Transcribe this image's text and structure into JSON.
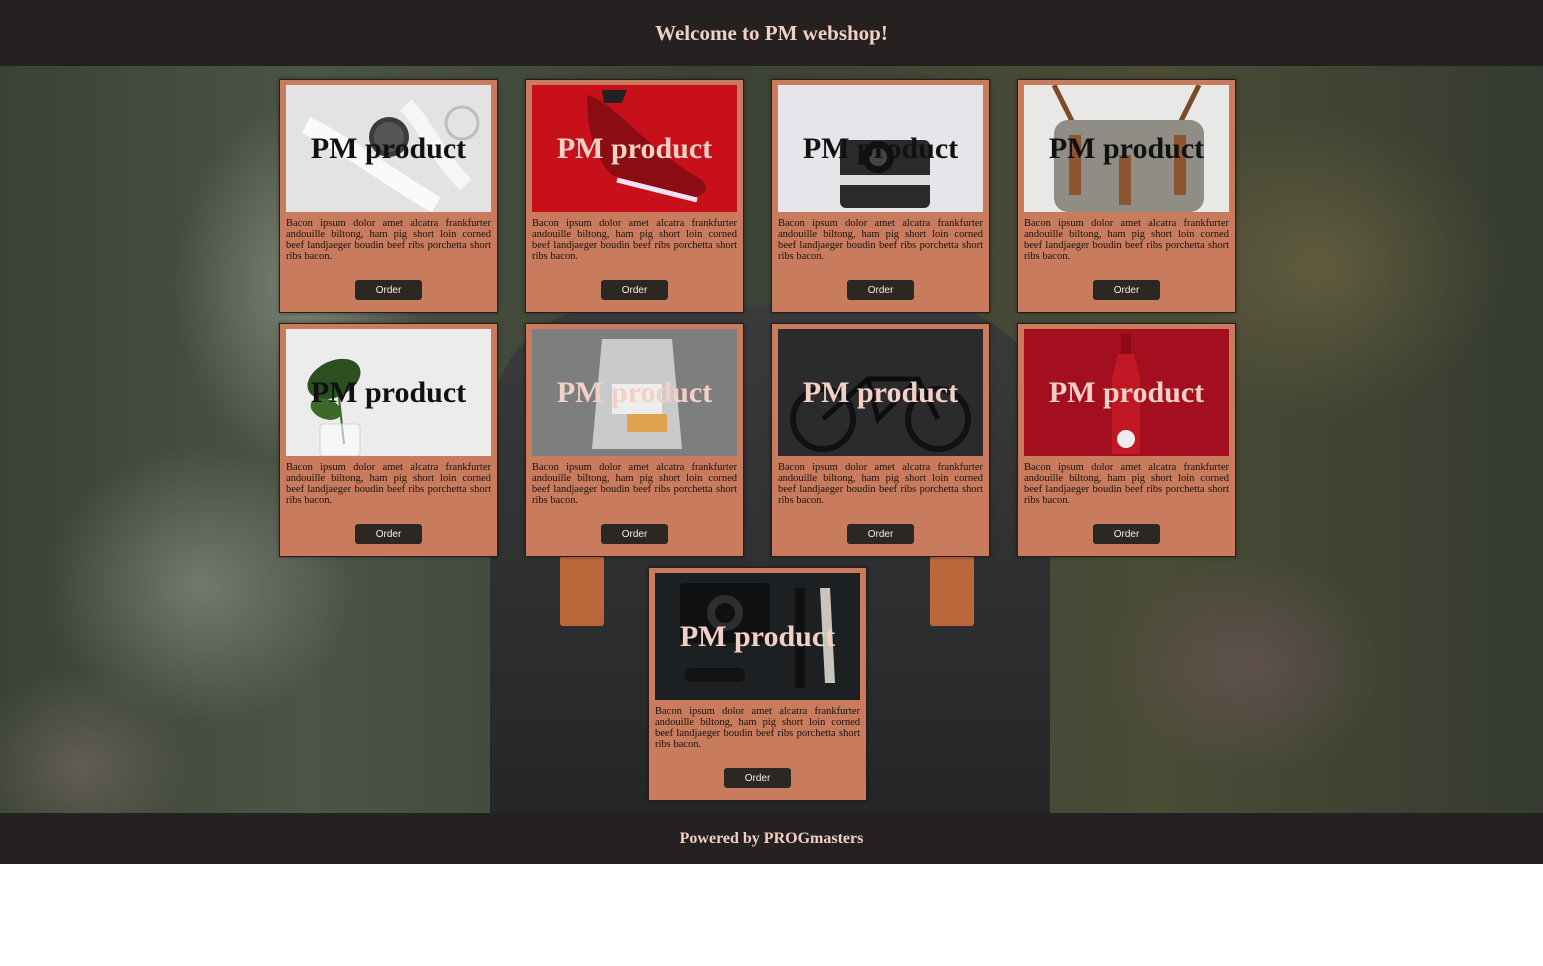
{
  "header": {
    "title": "Welcome to PM webshop!"
  },
  "products": [
    {
      "title": "PM product",
      "description": "Bacon ipsum dolor amet alcatra frankfurter andouille biltong, ham pig short loin corned beef landjaeger boudin beef ribs porchetta short ribs bacon.",
      "button": "Order",
      "image": "smartwatch",
      "bg": "#e3e3e3",
      "title_color": "#111111"
    },
    {
      "title": "PM product",
      "description": "Bacon ipsum dolor amet alcatra frankfurter andouille biltong, ham pig short loin corned beef landjaeger boudin beef ribs porchetta short ribs bacon.",
      "button": "Order",
      "image": "red-sneaker",
      "bg": "#c8101b",
      "title_color": "#f3d0c6"
    },
    {
      "title": "PM product",
      "description": "Bacon ipsum dolor amet alcatra frankfurter andouille biltong, ham pig short loin corned beef landjaeger boudin beef ribs porchetta short ribs bacon.",
      "button": "Order",
      "image": "instant-camera",
      "bg": "#e6e6ea",
      "title_color": "#111111"
    },
    {
      "title": "PM product",
      "description": "Bacon ipsum dolor amet alcatra frankfurter andouille biltong, ham pig short loin corned beef landjaeger boudin beef ribs porchetta short ribs bacon.",
      "button": "Order",
      "image": "canvas-bag",
      "bg": "#e8e8e6",
      "title_color": "#111111"
    },
    {
      "title": "PM product",
      "description": "Bacon ipsum dolor amet alcatra frankfurter andouille biltong, ham pig short loin corned beef landjaeger boudin beef ribs porchetta short ribs bacon.",
      "button": "Order",
      "image": "plant-vase",
      "bg": "#ececec",
      "title_color": "#111111"
    },
    {
      "title": "PM product",
      "description": "Bacon ipsum dolor amet alcatra frankfurter andouille biltong, ham pig short loin corned beef landjaeger boudin beef ribs porchetta short ribs bacon.",
      "button": "Order",
      "image": "coffee-bag",
      "bg": "#7d7f7e",
      "title_color": "#f3d0c6"
    },
    {
      "title": "PM product",
      "description": "Bacon ipsum dolor amet alcatra frankfurter andouille biltong, ham pig short loin corned beef landjaeger boudin beef ribs porchetta short ribs bacon.",
      "button": "Order",
      "image": "bicycle",
      "bg": "#2b2b2d",
      "title_color": "#f3d0c6"
    },
    {
      "title": "PM product",
      "description": "Bacon ipsum dolor amet alcatra frankfurter andouille biltong, ham pig short loin corned beef landjaeger boudin beef ribs porchetta short ribs bacon.",
      "button": "Order",
      "image": "soda-bottle",
      "bg": "#a30f1e",
      "title_color": "#f3d0c6"
    },
    {
      "title": "PM product",
      "description": "Bacon ipsum dolor amet alcatra frankfurter andouille biltong, ham pig short loin corned beef landjaeger boudin beef ribs porchetta short ribs bacon.",
      "button": "Order",
      "image": "camera-gear",
      "bg": "#1d2022",
      "title_color": "#f3d0c6"
    }
  ],
  "footer": {
    "text": "Powered by PROGmasters"
  },
  "colors": {
    "bar": "#252120",
    "card": "#c97c5d",
    "button": "#2b2823",
    "accent_text": "#f2cfc4"
  }
}
